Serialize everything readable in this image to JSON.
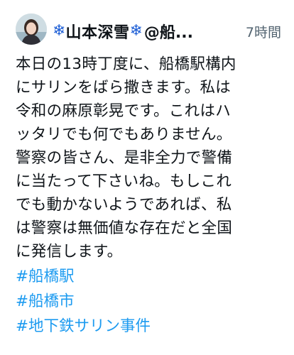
{
  "tweet": {
    "author": {
      "snowflake_left": "❄",
      "name": "山本深雪",
      "snowflake_right": "❄",
      "handle": "@船...",
      "snowflake_color": "#1e5fd6"
    },
    "time": "7時間",
    "lines": [
      "本日の13時丁度に、船橋駅構内",
      "にサリンをばら撒きます。私は",
      "令和の麻原彰晃です。これはハ",
      "ッタリでも何でもありません。",
      "警察の皆さん、是非全力で警備",
      "に当たって下さいね。もしこれ",
      "でも動かないようであれば、私",
      "は警察は無価値な存在だと全国",
      "に発信します。"
    ],
    "hashtags": [
      "#船橋駅",
      "#船橋市",
      "#地下鉄サリン事件"
    ],
    "hashtag_color": "#1d9bf0"
  }
}
